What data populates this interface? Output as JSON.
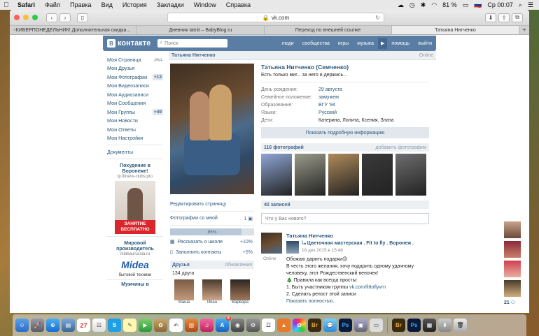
{
  "menubar": {
    "items": [
      "Safari",
      "Файл",
      "Правка",
      "Вид",
      "История",
      "Закладки",
      "Window",
      "Справка"
    ],
    "battery": "81 %",
    "clock": "Ср 00:07"
  },
  "browser": {
    "address": "vk.com",
    "tabs": [
      "КИБЕРПОНЕДЕЛЬНИК! Дополнительная скидка...",
      "Дневник tatnit – BabyBlog.ru",
      "Переход по внешней ссылке",
      "Татьяна Нитченко"
    ]
  },
  "vk": {
    "logo": "контакте",
    "logo_letter": "В",
    "search_placeholder": "Поиск",
    "nav": [
      "люди",
      "сообщества",
      "игры",
      "музыка",
      "помощь",
      "выйти"
    ],
    "left_menu": {
      "items": [
        {
          "label": "Моя Страница",
          "extra": "ред."
        },
        {
          "label": "Мои Друзья",
          "extra": ""
        },
        {
          "label": "Мои Фотографии",
          "extra": "+13"
        },
        {
          "label": "Мои Видеозаписи",
          "extra": ""
        },
        {
          "label": "Мои Аудиозаписи",
          "extra": ""
        },
        {
          "label": "Мои Сообщения",
          "extra": ""
        },
        {
          "label": "Мои Группы",
          "extra": "+49"
        },
        {
          "label": "Мои Новости",
          "extra": ""
        },
        {
          "label": "Мои Ответы",
          "extra": ""
        },
        {
          "label": "Мои Настройки",
          "extra": ""
        }
      ],
      "documents": "Документы"
    },
    "ads": [
      {
        "title": "Похудение в Воронеже!",
        "site": "lp.fitness-clubs.pro",
        "caption": "ЗАНЯТИЕ БЕСПЛАТНО"
      },
      {
        "title": "Мировой производитель",
        "site": "mideaurussia.ru",
        "logo": "Midea",
        "footer": "бытовой техники"
      },
      {
        "title": "Мужчины в"
      }
    ],
    "profile": {
      "header_name": "Татьяна Нитченко",
      "online": "Online",
      "full_name": "Татьяна Нитченко (Семченко)",
      "status": "Есть только миг... за него и держись...",
      "info": [
        {
          "key": "День рождения:",
          "value": "29 августа",
          "link": true
        },
        {
          "key": "Семейное положение:",
          "value": "замужем",
          "link": true
        },
        {
          "key": "Образование:",
          "value": "ВГУ '94",
          "link": true
        },
        {
          "key": "Языки:",
          "value": "Русский",
          "link": true
        },
        {
          "key": "Дети:",
          "value": "Катерина, Лолита, Ксения, Злата",
          "link": false
        }
      ],
      "more_info": "Показать подробную информацию",
      "links": {
        "edit": "Редактировать страницу",
        "photos_with_me": "Фотографии со мной",
        "photos_with_me_count": "1",
        "progress": "85%",
        "progress_value": 0.85,
        "tip_school": "Рассказать о школе",
        "tip_school_pct": "+10%",
        "tip_contacts": "Заполнить контакты",
        "tip_contacts_pct": "+5%"
      },
      "friends": {
        "title": "Друзья",
        "updates": "обновления",
        "count": "134 друга",
        "names": [
          "Маша",
          "Иван",
          "Варвара"
        ]
      },
      "photos": {
        "title": "116 фотографий",
        "add": "добавить фотографии",
        "colors": [
          "#8fa6d6",
          "#9a9a8a",
          "#b08a5a",
          "#3a3a3a",
          "#6e6e70"
        ]
      },
      "wall": {
        "title": "40 записей",
        "placeholder": "Что у Вас нового?",
        "post": {
          "author": "Татьяна Нитченко",
          "online": "Online",
          "repost_title": "Цветочная мастерская . Fit to fly . Воронеж .",
          "repost_date": "18 дек 2015 в 15:48",
          "lines": [
            "Обожаю дарить подарки😊",
            "В честь этого желания, хочу подарить одному удачному",
            "человеку, этот Рождественский веночек!",
            "🎄 Правила как всегда просты:",
            "1. Быть участником группы ",
            "2. Сделать репост этой записи"
          ],
          "link": "vk.com/fittoflyvrn",
          "show_more": "Показать полностью.."
        }
      }
    },
    "right_sidebar": {
      "count": "21"
    }
  },
  "dock": {
    "calendar_day": "27",
    "bridge_label": "Br",
    "photoshop_label": "Ps",
    "badge": "8"
  }
}
